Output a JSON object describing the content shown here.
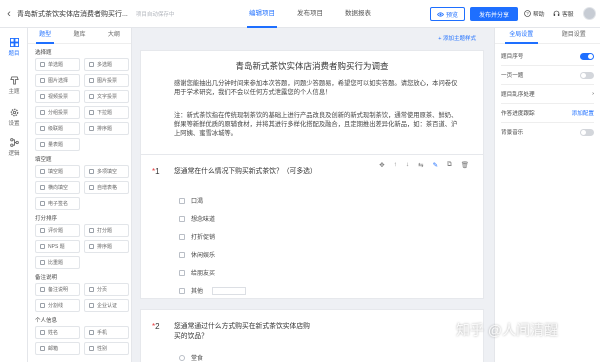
{
  "header": {
    "doc_title": "青岛新式茶饮实体店消费者购买行...",
    "autosave": "项目自动保存中",
    "tabs": [
      "编辑项目",
      "发布项目",
      "数据报表"
    ],
    "preview": "预览",
    "publish": "发布并分享",
    "help": "帮助",
    "service": "客服"
  },
  "rail": [
    {
      "label": "题目",
      "icon": "list-icon"
    },
    {
      "label": "主题",
      "icon": "theme-icon"
    },
    {
      "label": "设置",
      "icon": "gear-icon"
    },
    {
      "label": "逻辑",
      "icon": "logic-icon"
    }
  ],
  "palette": {
    "tabs": [
      "题型",
      "题库",
      "大纲"
    ],
    "groups": [
      {
        "title": "选择题",
        "items": [
          "单选题",
          "多选题",
          "图片选择",
          "图片投票",
          "视频投票",
          "文字投票",
          "分组投票",
          "下拉题",
          "级联题",
          "排序题",
          "量表题"
        ]
      },
      {
        "title": "填空题",
        "items": [
          "填空题",
          "多项填空",
          "横向填空",
          "自增表格",
          "电子签名"
        ]
      },
      {
        "title": "打分排序",
        "items": [
          "评价题",
          "打分题",
          "NPS 题",
          "排序题",
          "比重题"
        ]
      },
      {
        "title": "备注说明",
        "items": [
          "备注说明",
          "分页",
          "分割线",
          "企业认证"
        ]
      },
      {
        "title": "个人信息",
        "items": [
          "姓名",
          "手机",
          "邮箱",
          "性别"
        ]
      }
    ]
  },
  "canvas": {
    "add_theme": "+ 添加主题样式",
    "title": "青岛新式茶饮实体店消费者购买行为调查",
    "intro": "感谢您能抽出几分钟时间来参加本次答题，问题少答题易，希望您可以如实答题。请您放心，本问卷仅用于学术研究，我们不会以任何方式泄露您的个人信息！",
    "note": "注：新式茶饮指在传统现制茶饮的基础上进行产品改良及创新的新式现制茶饮，通常使用原茶、鲜奶、鲜果等新鲜优质的原辅食材，并将其进行多样化搭配及融合，且定期推出差异化新品，如：茶百道、沪上阿姨、蜜雪冰城等。",
    "q1": {
      "num": "1",
      "text": "您通常在什么情况下购买新式茶饮？（可多选）",
      "options": [
        "口渴",
        "想念味道",
        "打折促销",
        "休闲娱乐",
        "给朋友买"
      ],
      "other": "其他"
    },
    "q2": {
      "num": "2",
      "text": "您通常通过什么方式购买在新式茶饮实体店购买的饮品？",
      "options": [
        "堂食"
      ]
    }
  },
  "settings": {
    "tabs": [
      "全局设置",
      "题目设置"
    ],
    "rows": [
      {
        "label": "题目序号",
        "toggle": true
      },
      {
        "label": "一页一题",
        "toggle": false
      },
      {
        "label": "题目乱序处理"
      },
      {
        "label": "作答进度跟踪",
        "link": "添加配置"
      },
      {
        "label": "背景音乐",
        "toggle": false
      }
    ]
  },
  "watermark": "知乎 @人间清醒"
}
